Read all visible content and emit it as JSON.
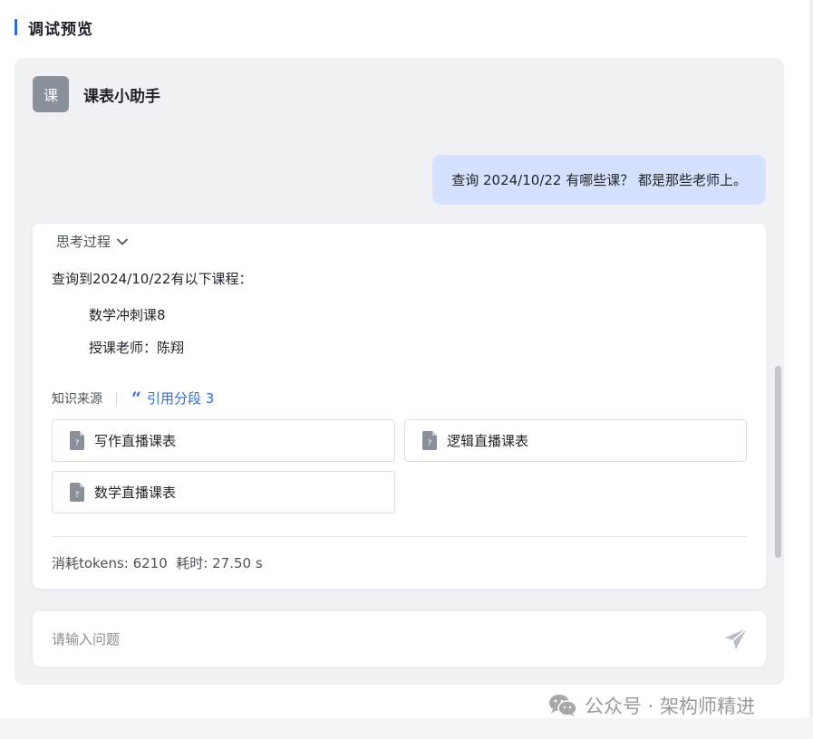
{
  "section": {
    "title": "调试预览"
  },
  "bot": {
    "avatar_char": "课",
    "name": "课表小助手"
  },
  "user_message": {
    "text": "查询 2024/10/22 有哪些课？ 都是那些老师上。"
  },
  "answer": {
    "thinking_toggle_label": "思考过程",
    "intro": "查询到2024/10/22有以下课程：",
    "course_name": "数学冲刺课8",
    "teacher_line": "授课老师：陈翔"
  },
  "sources": {
    "label": "知识来源",
    "citation": "引用分段 3",
    "items": [
      {
        "title": "写作直播课表",
        "icon": "document-unknown-icon"
      },
      {
        "title": "逻辑直播课表",
        "icon": "document-unknown-icon"
      },
      {
        "title": "数学直播课表",
        "icon": "document-unknown-icon"
      }
    ]
  },
  "stats": {
    "text": "消耗tokens: 6210  耗时: 27.50 s"
  },
  "input": {
    "placeholder": "请输入问题",
    "value": "",
    "send_icon": "send-icon"
  },
  "watermark": {
    "text": "公众号 · 架构师精进",
    "icon": "wechat-icon"
  },
  "colors": {
    "accent": "#2f6bdb",
    "user_bubble": "#d6e2fd",
    "panel_bg": "#eff1f5",
    "avatar_bg": "#8a9099"
  }
}
